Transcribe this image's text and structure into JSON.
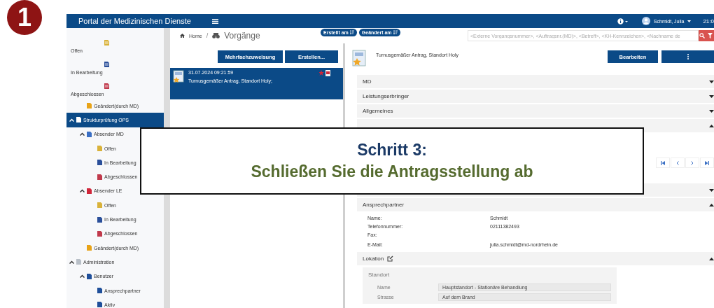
{
  "step_marker": {
    "number": "1"
  },
  "topbar": {
    "title": "Portal der Medizinischen Dienste",
    "user": "Schmidt, Julia",
    "time": "21:0"
  },
  "sidebar": {
    "stacked_items": [
      {
        "label": "Offen",
        "kind": "open"
      },
      {
        "label": "In Bearbeitung",
        "kind": "progress"
      },
      {
        "label": "Abgeschlossen",
        "kind": "closed"
      }
    ],
    "tree": [
      {
        "kind": "continued",
        "children": [
          {
            "label": "Geändert(durch MD)",
            "kind": "changed",
            "selected": false
          }
        ]
      },
      {
        "label": "Strukturprüfung OPS",
        "kind": "ops",
        "selected": true,
        "expanded": true,
        "children": [
          {
            "label": "Absender MD",
            "kind": "sender-md",
            "selected": false,
            "expanded": true,
            "children": [
              {
                "label": "Offen",
                "kind": "open",
                "selected": false
              },
              {
                "label": "In Bearbeitung",
                "kind": "progress",
                "selected": false
              },
              {
                "label": "Abgeschlossen",
                "kind": "closed",
                "selected": false
              }
            ]
          },
          {
            "label": "Absender LE",
            "kind": "sender-le",
            "selected": false,
            "expanded": true,
            "children": [
              {
                "label": "Offen",
                "kind": "open",
                "selected": false
              },
              {
                "label": "In Bearbeitung",
                "kind": "progress",
                "selected": false
              },
              {
                "label": "Abgeschlossen",
                "kind": "closed",
                "selected": false
              }
            ]
          },
          {
            "label": "Geändert(durch MD)",
            "kind": "changed",
            "selected": false
          }
        ]
      },
      {
        "label": "Administration",
        "kind": "admin",
        "selected": false,
        "expanded": true,
        "children": [
          {
            "label": "Benutzer",
            "kind": "user",
            "selected": false,
            "expanded": true,
            "children": [
              {
                "label": "Ansprechpartner",
                "kind": "user",
                "selected": false
              },
              {
                "label": "Aktiv",
                "kind": "user",
                "selected": false
              }
            ]
          }
        ]
      }
    ]
  },
  "breadcrumb": [
    {
      "label": "Home",
      "kind": "home"
    },
    {
      "label": "Vorgänge",
      "kind": "binoculars",
      "separator": "/"
    }
  ],
  "sort_badges": [
    {
      "label": "Erstellt am"
    },
    {
      "label": "Geändert am"
    }
  ],
  "search": {
    "placeholder": "<Externe Vorgangsnummer>, <Auftragsnr.(MD)>, <Betreff>, <KH-Kennzeichen>, <Nachname de"
  },
  "list": {
    "buttons": [
      "Mehrfachzuweisung",
      "Erstellen..."
    ],
    "items": [
      {
        "date": "31.07.2024 09:21:59",
        "subject": "Turnusgemäßer Antrag, Standort Holy;",
        "selected": true
      }
    ]
  },
  "detail": {
    "title": "Turnusgemäßer Antrag, Standort Holy",
    "buttons": [
      {
        "kind": "text",
        "label": "Bearbeiten"
      },
      {
        "kind": "more"
      }
    ],
    "sections": [
      {
        "title": "MD",
        "expanded": false
      },
      {
        "title": "Leistungserbringer",
        "expanded": false
      },
      {
        "title": "Allgemeines",
        "expanded": false
      },
      {
        "kind": "pager",
        "expanded": true
      },
      {
        "expanded": false
      },
      {
        "title": "Ansprechpartner",
        "kind": "fields",
        "expanded": true,
        "fields": [
          {
            "label": "Name:",
            "value": "Schmidt"
          },
          {
            "label": "Telefonnummer:",
            "value": "02111382493"
          },
          {
            "label": "Fax:"
          },
          {
            "label": "E-Mail:",
            "value": "julia.schmidt@md-nordrhein.de"
          }
        ]
      },
      {
        "title": "Lokation",
        "kind": "card",
        "editable": true,
        "expanded": true,
        "card": {
          "title": "Standort",
          "fields": [
            {
              "label": "Name",
              "value": "Hauptstandort - Stationäre Behandlung"
            },
            {
              "label": "Strasse",
              "value": "Auf dem Brand"
            }
          ]
        }
      }
    ]
  },
  "callout": {
    "heading": "Schritt 3:",
    "text": "Schließen Sie die Antragsstellung ab"
  }
}
